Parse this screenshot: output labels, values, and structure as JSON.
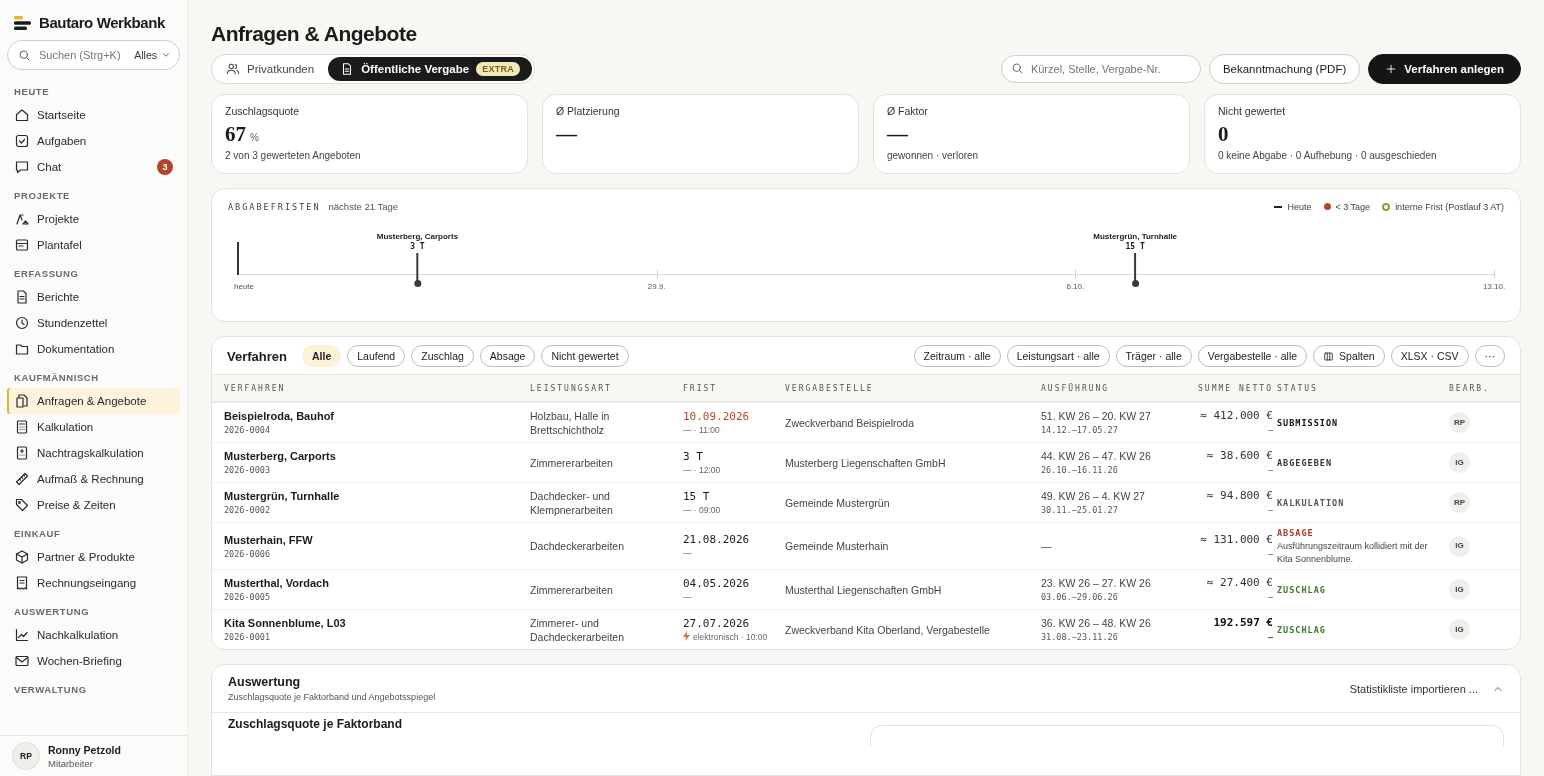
{
  "sidebar": {
    "brand": "Bautaro Werkbank",
    "search": {
      "placeholder": "Suchen (Strg+K)",
      "scope": "Alles"
    },
    "sections": [
      {
        "title": "HEUTE",
        "items": [
          {
            "label": "Startseite",
            "selected": false
          },
          {
            "label": "Aufgaben",
            "selected": false
          },
          {
            "label": "Chat",
            "selected": false,
            "badge": "3"
          }
        ]
      },
      {
        "title": "PROJEKTE",
        "items": [
          {
            "label": "Projekte",
            "selected": false
          },
          {
            "label": "Plantafel",
            "selected": false
          }
        ]
      },
      {
        "title": "ERFASSUNG",
        "items": [
          {
            "label": "Berichte",
            "selected": false
          },
          {
            "label": "Stundenzettel",
            "selected": false
          },
          {
            "label": "Dokumentation",
            "selected": false
          }
        ]
      },
      {
        "title": "KAUFMÄNNISCH",
        "items": [
          {
            "label": "Anfragen & Angebote",
            "selected": true
          },
          {
            "label": "Kalkulation",
            "selected": false
          },
          {
            "label": "Nachtragskalkulation",
            "selected": false
          },
          {
            "label": "Aufmaß & Rechnung",
            "selected": false
          },
          {
            "label": "Preise & Zeiten",
            "selected": false
          }
        ]
      },
      {
        "title": "EINKAUF",
        "items": [
          {
            "label": "Partner & Produkte",
            "selected": false
          },
          {
            "label": "Rechnungseingang",
            "selected": false
          }
        ]
      },
      {
        "title": "AUSWERTUNG",
        "items": [
          {
            "label": "Nachkalkulation",
            "selected": false
          },
          {
            "label": "Wochen-Briefing",
            "selected": false
          }
        ]
      },
      {
        "title": "VERWALTUNG"
      }
    ],
    "user": {
      "initials": "RP",
      "name": "Ronny Petzold",
      "role": "Mitarbeiter"
    }
  },
  "page": {
    "title": "Anfragen & Angebote",
    "tabs": [
      {
        "label": "Privatkunden",
        "selected": false
      },
      {
        "label": "Öffentliche Vergabe",
        "selected": true,
        "badge": "EXTRA"
      }
    ],
    "search": {
      "placeholder": "Kürzel, Stelle, Vergabe-Nr."
    },
    "buttons": [
      {
        "label": "Bekanntmachung (PDF)",
        "kind": "secondary"
      },
      {
        "label": "Verfahren anlegen",
        "kind": "primary"
      }
    ]
  },
  "kpis": [
    {
      "label": "Zuschlagsquote",
      "value": "67",
      "unit": "%",
      "sub": "2 von 3 gewerteten Angeboten"
    },
    {
      "label": "Ø Platzierung",
      "value": "—"
    },
    {
      "label": "Ø Faktor",
      "value": "—",
      "sub": "gewonnen · verloren"
    },
    {
      "label": "Nicht gewertet",
      "value": "0",
      "sub": "0 keine Abgabe · 0 Aufhebung · 0 ausgeschieden"
    }
  ],
  "deadlines": {
    "title": "ABGABEFRISTEN",
    "subtitle": "nächste 21 Tage",
    "legend": [
      {
        "label": "Heute",
        "kind": "line"
      },
      {
        "label": "< 3 Tage",
        "kind": "dot",
        "color": "#b2452b"
      },
      {
        "label": "interne Frist (Postlauf 3 AT)",
        "kind": "ring",
        "color": "#9a9a2e"
      }
    ],
    "today_label": "heute",
    "dates": [
      "29.9.",
      "6.10.",
      "13.10."
    ],
    "markers": [
      {
        "label": "Musterberg, Carports",
        "remaining": "3 T"
      },
      {
        "label": "Mustergrün, Turnhalle",
        "remaining": "15 T"
      }
    ]
  },
  "table": {
    "title": "Verfahren",
    "filters": [
      {
        "label": "Alle",
        "selected": true
      },
      {
        "label": "Laufend",
        "selected": false
      },
      {
        "label": "Zuschlag",
        "selected": false
      },
      {
        "label": "Absage",
        "selected": false
      },
      {
        "label": "Nicht gewertet",
        "selected": false
      }
    ],
    "tools": [
      {
        "label": "Zeitraum · alle"
      },
      {
        "label": "Leistungsart · alle"
      },
      {
        "label": "Träger · alle"
      },
      {
        "label": "Vergabestelle · alle"
      },
      {
        "label": "Spalten",
        "kind": "columns"
      },
      {
        "label": "XLSX · CSV"
      },
      {
        "label": "···"
      }
    ],
    "columns": [
      "VERFAHREN",
      "LEISTUNGSART",
      "FRIST",
      "VERGABESTELLE",
      "AUSFÜHRUNG",
      "SUMME NETTO",
      "STATUS",
      "BEARB."
    ],
    "rows": [
      {
        "name": "Beispielroda, Bauhof",
        "code": "2026-0004",
        "work": "Holzbau, Halle in Brettschichtholz",
        "due": "10.09.2026",
        "due_sub": "— · 11:00",
        "urgent": true,
        "electronic": false,
        "authority": "Zweckverband Beispielroda",
        "period": "51. KW 26 – 20. KW 27",
        "dates": "14.12.–17.05.27",
        "sum": "≈ 412.000 €",
        "sum_sub": "—",
        "final": false,
        "status": {
          "label": "SUBMISSION",
          "color": "#111111"
        },
        "editor": "RP"
      },
      {
        "name": "Musterberg, Carports",
        "code": "2026-0003",
        "work": "Zimmererarbeiten",
        "due": "3 T",
        "due_sub": "— · 12:00",
        "urgent": false,
        "electronic": false,
        "authority": "Musterberg Liegenschaften GmbH",
        "period": "44. KW 26 – 47. KW 26",
        "dates": "26.10.–16.11.26",
        "sum": "≈ 38.600 €",
        "sum_sub": "—",
        "final": false,
        "status": {
          "label": "ABGEGEBEN",
          "color": "#333333"
        },
        "editor": "IG"
      },
      {
        "name": "Mustergrün, Turnhalle",
        "code": "2026-0002",
        "work": "Dachdecker- und Klempnerarbeiten",
        "due": "15 T",
        "due_sub": "— · 09:00",
        "urgent": false,
        "electronic": false,
        "authority": "Gemeinde Mustergrün",
        "period": "49. KW 26 – 4. KW 27",
        "dates": "30.11.–25.01.27",
        "sum": "≈ 94.800 €",
        "sum_sub": "—",
        "final": false,
        "status": {
          "label": "KALKULATION",
          "color": "#555555"
        },
        "editor": "RP"
      },
      {
        "name": "Musterhain, FFW",
        "code": "2026-0006",
        "work": "Dachdeckerarbeiten",
        "due": "21.08.2026",
        "due_sub": "—",
        "urgent": false,
        "electronic": false,
        "authority": "Gemeinde Musterhain",
        "period": "—",
        "sum": "≈ 131.000 €",
        "sum_sub": "—",
        "final": false,
        "status": {
          "label": "ABSAGE",
          "color": "#a33b25",
          "note": "Ausführungszeitraum kollidiert mit der Kita Sonnenblume."
        },
        "editor": "IG"
      },
      {
        "name": "Musterthal, Vordach",
        "code": "2026-0005",
        "work": "Zimmererarbeiten",
        "due": "04.05.2026",
        "due_sub": "—",
        "urgent": false,
        "electronic": false,
        "authority": "Musterthal Liegenschaften GmbH",
        "period": "23. KW 26 – 27. KW 26",
        "dates": "03.06.–29.06.26",
        "sum": "≈ 27.400 €",
        "sum_sub": "—",
        "final": false,
        "status": {
          "label": "ZUSCHLAG",
          "color": "#3f7a2c"
        },
        "editor": "IG"
      },
      {
        "name": "Kita Sonnenblume, L03",
        "code": "2026-0001",
        "work": "Zimmerer- und Dachdeckerarbeiten",
        "due": "27.07.2026",
        "due_sub": "elektronisch · 10:00",
        "urgent": false,
        "electronic": true,
        "authority": "Zweckverband Kita Oberland, Vergabestelle",
        "period": "36. KW 26 – 48. KW 26",
        "dates": "31.08.–23.11.26",
        "sum": "192.597 €",
        "sum_sub": "—",
        "final": true,
        "status": {
          "label": "ZUSCHLAG",
          "color": "#3f7a2c"
        },
        "editor": "IG"
      }
    ]
  },
  "evaluation": {
    "title": "Auswertung",
    "subtitle": "Zuschlagsquote je Faktorband und Angebotsspiegel",
    "action": "Statistikliste importieren ...",
    "expanded": true,
    "section_title": "Zuschlagsquote je Faktorband"
  }
}
